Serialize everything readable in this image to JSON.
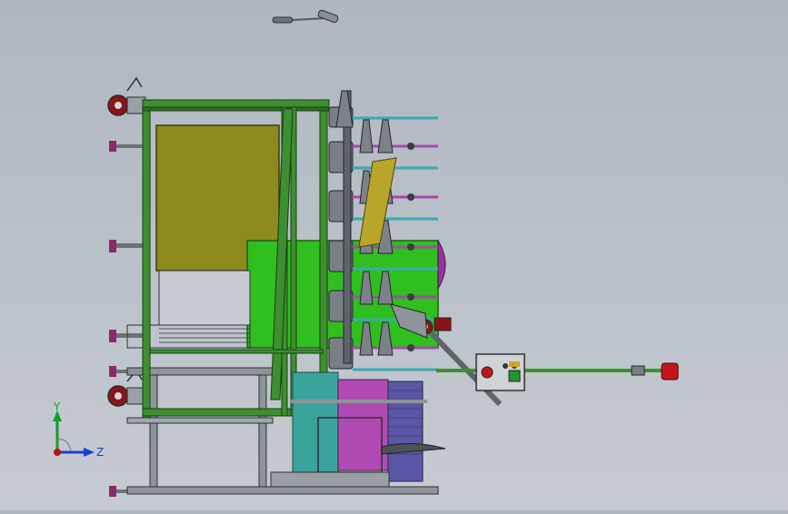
{
  "view": {
    "background_top": "#aeb6c0",
    "background_bottom": "#c6cbd1"
  },
  "triad": {
    "x_label": "",
    "y_label": "Y",
    "z_label": "Z",
    "y_color": "#1a9a2a",
    "z_color": "#1f3fd1",
    "origin_color": "#c0101a"
  },
  "palette": {
    "frame_green": "#3d8f2f",
    "panel_olive": "#8f8a1e",
    "tank_green": "#2fbf1f",
    "rod_teal": "#3aa9b0",
    "rod_purple": "#a64aa8",
    "spool_gray": "#7a7f86",
    "roller_purple": "#5a57a6",
    "roller_teal": "#3aa39c",
    "roller_pink": "#b24ab3",
    "wheel_red": "#8a1418",
    "estop_red": "#c4141a"
  }
}
